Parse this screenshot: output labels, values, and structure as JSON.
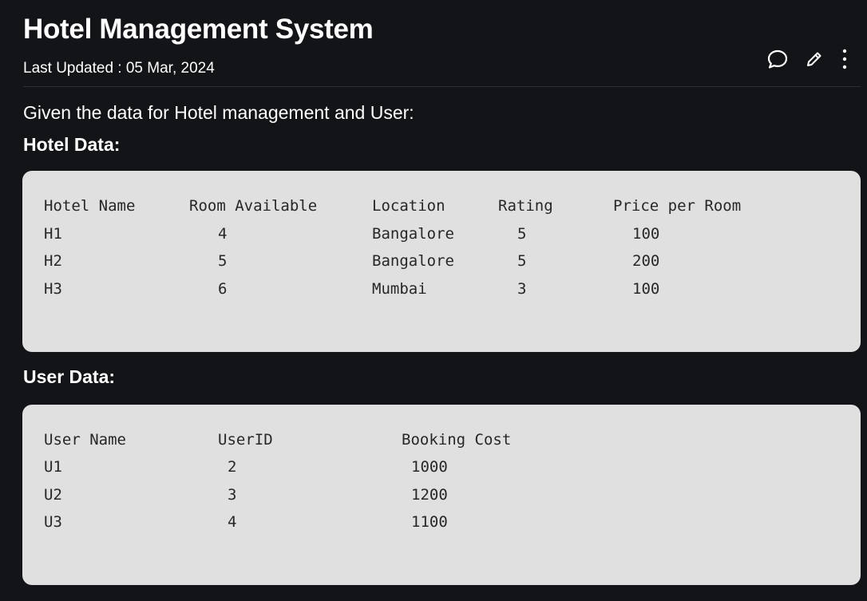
{
  "header": {
    "title": "Hotel Management System",
    "last_updated": "Last Updated : 05 Mar, 2024"
  },
  "actions": {
    "comment_icon": "comment-icon",
    "edit_icon": "pencil-icon",
    "more_icon": "more-vertical-icon"
  },
  "content": {
    "intro": "Given the data for Hotel management and User:",
    "hotel_heading": "Hotel Data:",
    "user_heading": "User Data:"
  },
  "hotel_table": {
    "headers": [
      "Hotel Name",
      "Room Available",
      "Location",
      "Rating",
      "Price per Room"
    ],
    "rows": [
      [
        "H1",
        "4",
        "Bangalore",
        "5",
        "100"
      ],
      [
        "H2",
        "5",
        "Bangalore",
        "5",
        "200"
      ],
      [
        "H3",
        "6",
        "Mumbai",
        "3",
        "100"
      ]
    ]
  },
  "user_table": {
    "headers": [
      "User Name",
      "UserID",
      "Booking Cost"
    ],
    "rows": [
      [
        "U1",
        "2",
        "1000"
      ],
      [
        "U2",
        "3",
        "1200"
      ],
      [
        "U3",
        "4",
        "1100"
      ]
    ]
  },
  "colors": {
    "background": "#131417",
    "code_background": "#e0e0e0",
    "code_text": "#272727",
    "text": "#ffffff"
  }
}
